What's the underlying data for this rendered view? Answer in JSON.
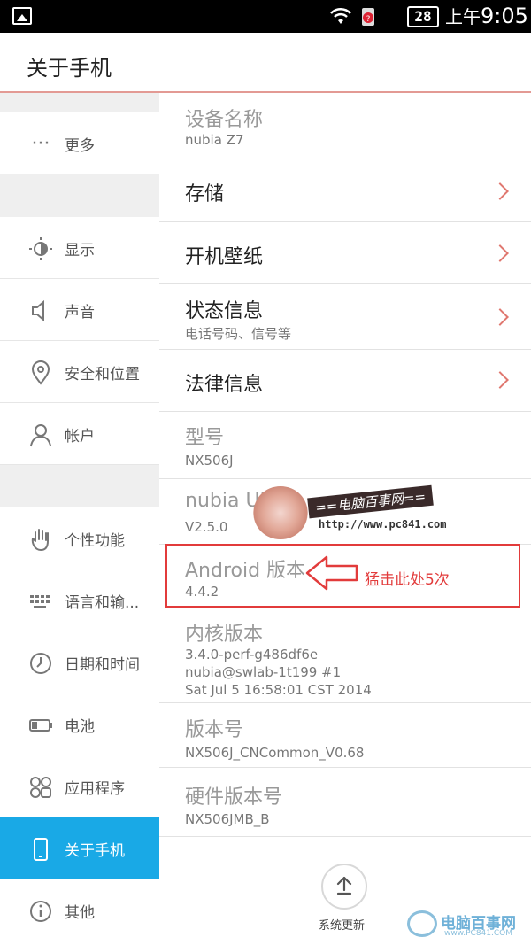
{
  "status_bar": {
    "battery_level": "28",
    "time_period": "上午",
    "time": "9:05"
  },
  "header": {
    "title": "关于手机"
  },
  "sidebar": {
    "items": [
      {
        "icon": "more-dots-icon",
        "label": "更多"
      },
      {
        "icon": "display-brightness-icon",
        "label": "显示"
      },
      {
        "icon": "speaker-icon",
        "label": "声音"
      },
      {
        "icon": "location-pin-icon",
        "label": "安全和位置"
      },
      {
        "icon": "person-icon",
        "label": "帐户"
      },
      {
        "icon": "hand-icon",
        "label": "个性功能"
      },
      {
        "icon": "keyboard-icon",
        "label": "语言和输..."
      },
      {
        "icon": "clock-icon",
        "label": "日期和时间"
      },
      {
        "icon": "battery-icon",
        "label": "电池"
      },
      {
        "icon": "apps-grid-icon",
        "label": "应用程序"
      },
      {
        "icon": "phone-icon",
        "label": "关于手机",
        "active": true
      },
      {
        "icon": "info-icon",
        "label": "其他"
      }
    ]
  },
  "content": {
    "device_name": {
      "label": "设备名称",
      "value": "nubia Z7"
    },
    "storage": {
      "label": "存储"
    },
    "boot_wallpaper": {
      "label": "开机壁纸"
    },
    "status_info": {
      "label": "状态信息",
      "value": "电话号码、信号等"
    },
    "legal_info": {
      "label": "法律信息"
    },
    "model": {
      "label": "型号",
      "value": "NX506J"
    },
    "nubia_ui": {
      "label": "nubia UI",
      "value": "V2.5.0"
    },
    "android_version": {
      "label": "Android 版本",
      "value": "4.4.2"
    },
    "kernel_version": {
      "label": "内核版本",
      "value_line1": "3.4.0-perf-g486df6e",
      "value_line2": "nubia@swlab-1t199 #1",
      "value_line3": "Sat Jul 5 16:58:01 CST 2014"
    },
    "build_number": {
      "label": "版本号",
      "value": "NX506J_CNCommon_V0.68"
    },
    "hardware_version": {
      "label": "硬件版本号",
      "value": "NX506JMB_B"
    }
  },
  "annotation": {
    "text": "猛击此处5次",
    "color": "#e23b3b"
  },
  "watermark": {
    "text": "==电脑百事网==",
    "url": "http://www.pc841.com"
  },
  "system_update": {
    "label": "系统更新"
  },
  "corner_logo": {
    "text": "电脑百事网",
    "sub": "www.PC841.COM"
  },
  "colors": {
    "accent": "#19a9e6",
    "chevron": "#e0776f",
    "header_divider": "#e39a94"
  }
}
